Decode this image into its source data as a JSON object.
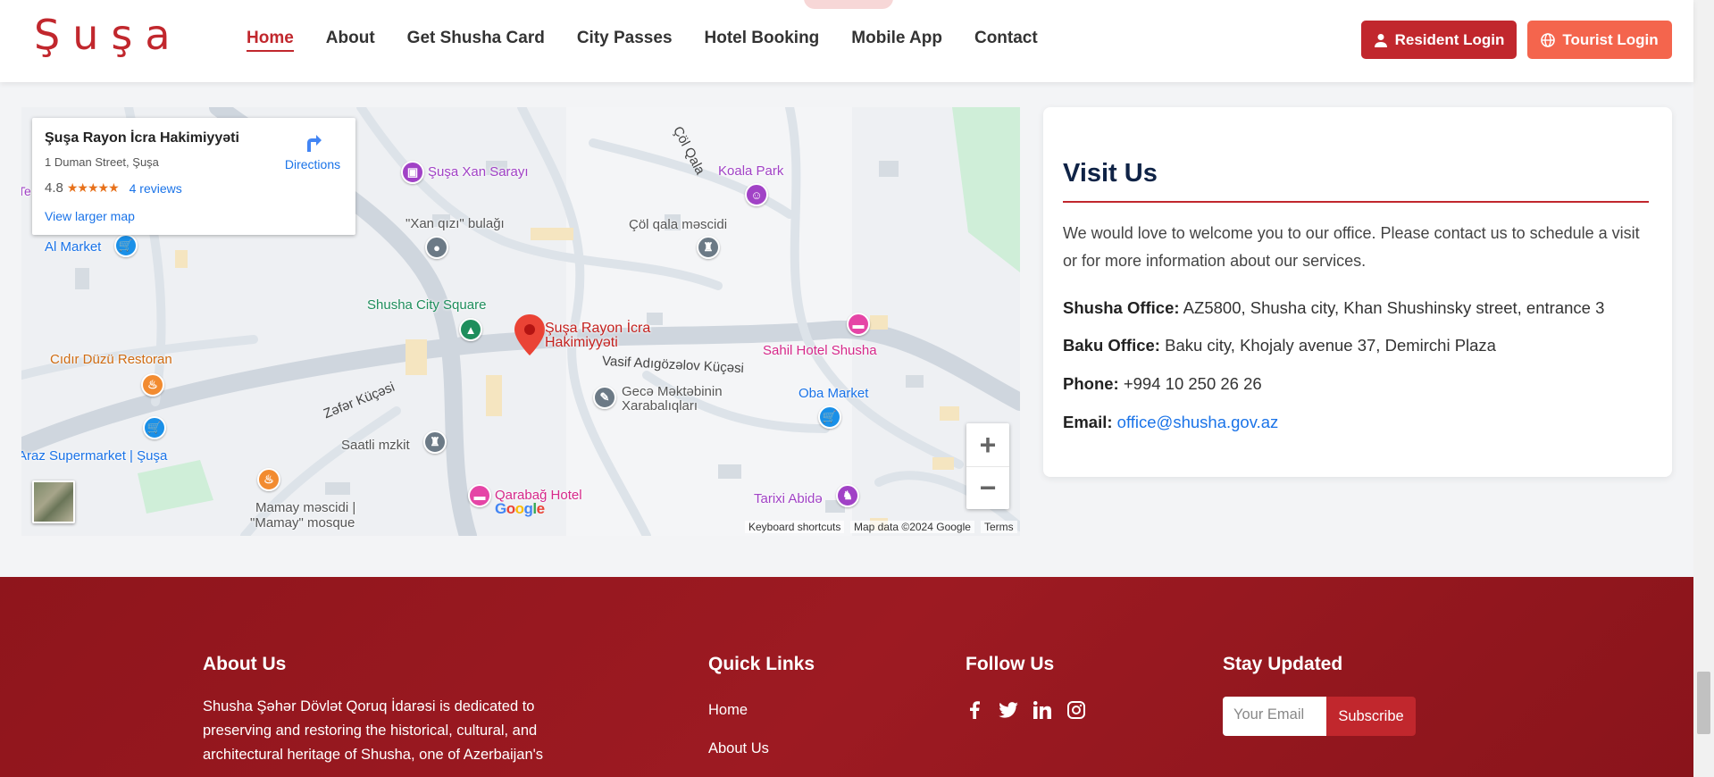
{
  "header": {
    "logo": "Şuşa",
    "nav": [
      {
        "label": "Home",
        "active": true
      },
      {
        "label": "About"
      },
      {
        "label": "Get Shusha Card"
      },
      {
        "label": "City Passes"
      },
      {
        "label": "Hotel Booking"
      },
      {
        "label": "Mobile App"
      },
      {
        "label": "Contact"
      }
    ],
    "resident_login": "Resident Login",
    "tourist_login": "Tourist Login",
    "icons": {
      "resident": "user-icon",
      "tourist": "globe-icon"
    }
  },
  "map": {
    "card": {
      "name": "Şuşa Rayon İcra Hakimiyyəti",
      "address": "1 Duman Street, Şuşa",
      "rating": "4.8",
      "stars": "★★★★★",
      "reviews": "4 reviews",
      "larger": "View larger map",
      "directions": "Directions"
    },
    "places": {
      "xan_sarayi": "Şuşa Xan Sarayı",
      "koala_park": "Koala Park",
      "xan_qizi": "\"Xan qızı\" bulağı",
      "col_qala_mescidi": "Çöl qala məscidi",
      "al_market": "Al Market",
      "city_square": "Shusha City Square",
      "main_pin_1": "Şuşa Rayon İcra",
      "main_pin_2": "Hakimiyyəti",
      "cidir_duzu": "Cıdır Düzü Restoran",
      "sahil_hotel": "Sahil Hotel Shusha",
      "gece_mekteb_1": "Gecə Məktəbinin",
      "gece_mekteb_2": "Xarabalıqları",
      "oba_market": "Oba Market",
      "saatli": "Saatli mzkit",
      "araz": "Araz Supermarket | Şuşa",
      "mamay_1": "Mamay məscidi |",
      "mamay_2": "\"Mamay\" mosque",
      "qarabag": "Qarabağ Hotel",
      "tarixi": "Tarixi Abidə",
      "te_label": "Te"
    },
    "roads": {
      "col_qala": "Çöl Qala",
      "vasif": "Vasif Adıgözəlov Küçəsi",
      "zefer": "Zəfər Küçəsi"
    },
    "google": "Google",
    "attrib": {
      "keyboard": "Keyboard shortcuts",
      "mapdata": "Map data ©2024 Google",
      "terms": "Terms"
    },
    "zoom_in": "+",
    "zoom_out": "−"
  },
  "visit": {
    "title": "Visit Us",
    "intro": "We would love to welcome you to our office. Please contact us to schedule a visit or for more information about our services.",
    "shusha_label": "Shusha Office:",
    "shusha_value": " AZ5800, Shusha city, Khan Shushinsky street, entrance 3",
    "baku_label": "Baku Office:",
    "baku_value": " Baku city, Khojaly avenue 37, Demirchi Plaza",
    "phone_label": "Phone:",
    "phone_value": " +994 10 250 26 26",
    "email_label": "Email:",
    "email_value": "office@shusha.gov.az"
  },
  "footer": {
    "about_title": "About Us",
    "about_text": "Shusha Şəhər Dövlət Qoruq İdarəsi is dedicated to preserving and restoring the historical, cultural, and architectural heritage of Shusha, one of Azerbaijan's",
    "quick_title": "Quick Links",
    "quick_links": [
      "Home",
      "About Us"
    ],
    "follow_title": "Follow Us",
    "social_icons": [
      "facebook-icon",
      "twitter-icon",
      "linkedin-icon",
      "instagram-icon"
    ],
    "updated_title": "Stay Updated",
    "email_placeholder": "Your Email",
    "subscribe": "Subscribe"
  },
  "colors": {
    "brand_red": "#c1272d",
    "tourist_orange": "#f4654d",
    "footer_red": "#9d1a22",
    "navy": "#0f2346",
    "link_blue": "#1a73e8"
  }
}
